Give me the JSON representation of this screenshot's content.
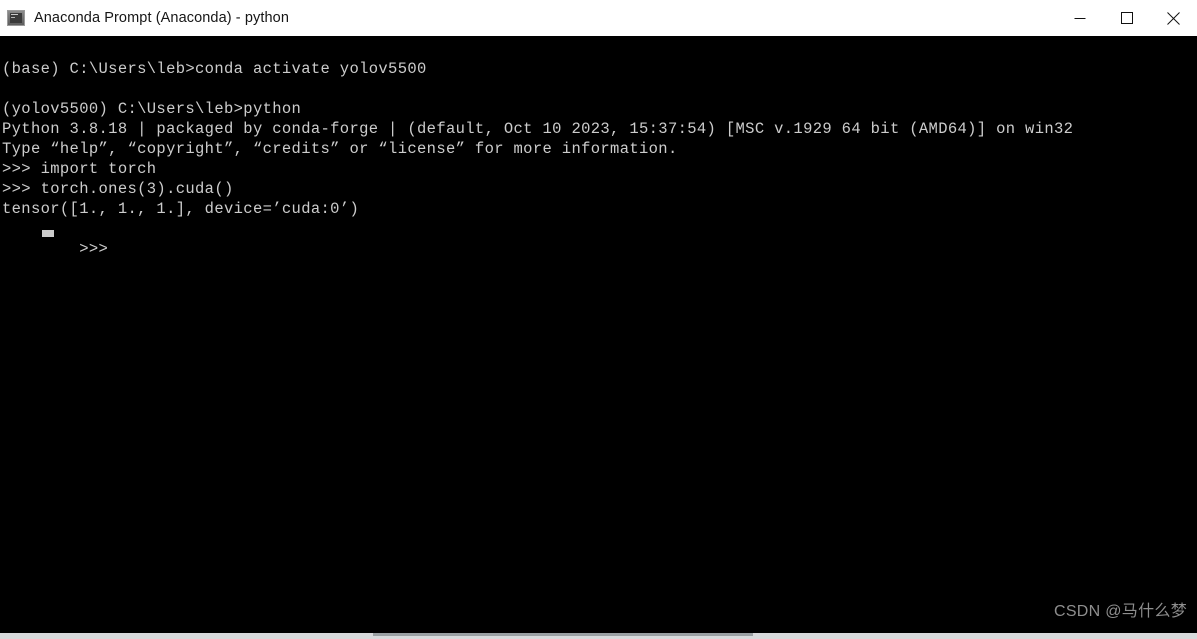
{
  "window": {
    "title": "Anaconda Prompt (Anaconda) - python",
    "icon": "console-icon",
    "controls": {
      "minimize": "minimize-icon",
      "maximize": "maximize-icon",
      "close": "close-icon"
    },
    "colors": {
      "titlebar_background": "#ffffff",
      "titlebar_text": "#161616",
      "terminal_background": "#000000",
      "terminal_text": "#cccccc",
      "watermark_text": "#8e8e8e"
    }
  },
  "terminal": {
    "lines": [
      "(base) C:\\Users\\leb>conda activate yolov5500",
      "",
      "(yolov5500) C:\\Users\\leb>python",
      "Python 3.8.18 | packaged by conda-forge | (default, Oct 10 2023, 15:37:54) [MSC v.1929 64 bit (AMD64)] on win32",
      "Type “help”, “copyright”, “credits” or “license” for more information.",
      ">>> import torch",
      ">>> torch.ones(3).cuda()",
      "tensor([1., 1., 1.], device=’cuda:0’)"
    ],
    "prompt": ">>>",
    "cursor": "block-cursor"
  },
  "watermark": {
    "text": "CSDN @马什么梦"
  }
}
